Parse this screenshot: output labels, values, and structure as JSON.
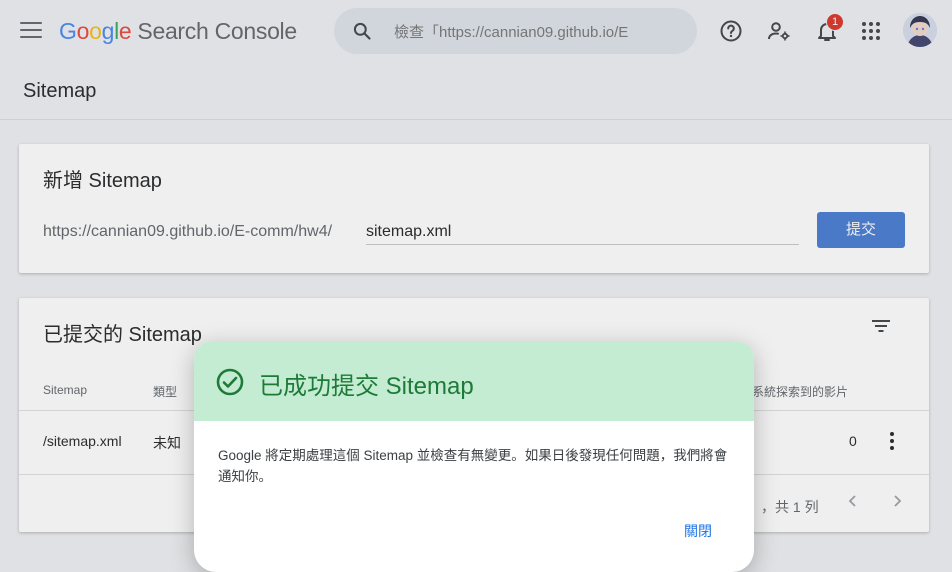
{
  "header": {
    "logo_letters": [
      "G",
      "o",
      "o",
      "g",
      "l",
      "e"
    ],
    "product": "Search Console",
    "search_placeholder": "檢查「https://cannian09.github.io/E",
    "notification_count": "1"
  },
  "page_title": "Sitemap",
  "add_card": {
    "title": "新增 Sitemap",
    "url_prefix": "https://cannian09.github.io/E-comm/hw4/",
    "input_value": "sitemap.xml",
    "submit_label": "提交"
  },
  "submitted_card": {
    "title": "已提交的 Sitemap",
    "columns": [
      "Sitemap",
      "類型",
      "系統探索到的影片"
    ],
    "rows": [
      {
        "sitemap": "/sitemap.xml",
        "type": "未知",
        "videos": "0"
      }
    ],
    "pagination_text": "，共 1 列"
  },
  "dialog": {
    "title": "已成功提交 Sitemap",
    "body": "Google 將定期處理這個 Sitemap 並檢查有無變更。如果日後發現任何問題，我們將會通知你。",
    "close_label": "關閉"
  },
  "colors": {
    "primary_button": "#4479d3",
    "success_header": "#c4ecd2",
    "success_text": "#1e7a38",
    "link": "#1a73e8",
    "badge": "#d93025"
  },
  "icons": {
    "menu": "menu-icon",
    "search": "search-icon",
    "help": "help-icon",
    "admin": "manage-accounts-icon",
    "notifications": "bell-icon",
    "apps": "apps-grid-icon",
    "filter": "filter-icon",
    "more": "more-vert-icon",
    "success": "check-circle-icon"
  }
}
